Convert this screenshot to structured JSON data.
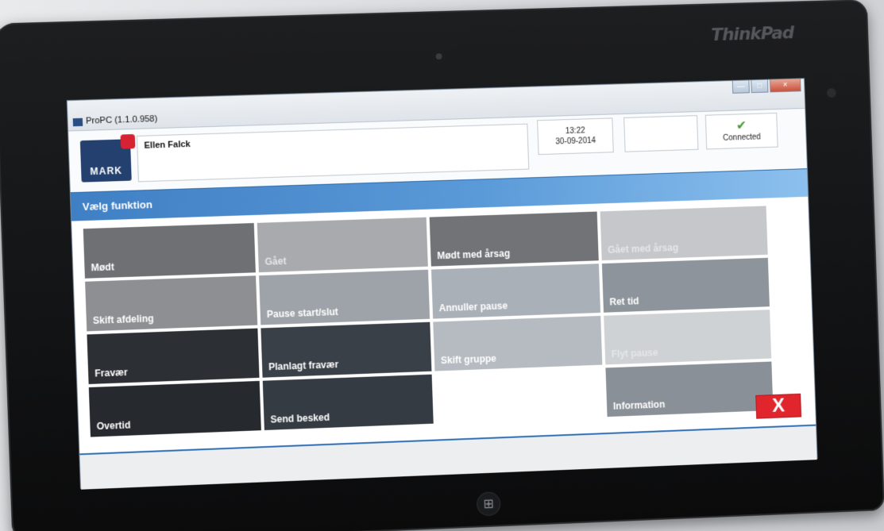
{
  "device": {
    "brand": "ThinkPad"
  },
  "window": {
    "title": "ProPC (1.1.0.958)",
    "controls": {
      "minimize": "—",
      "maximize": "□",
      "close": "×"
    }
  },
  "header": {
    "logo_text": "MARK",
    "user_name": "Ellen Falck",
    "time": "13:22",
    "date": "30-09-2014",
    "connection_status": "Connected",
    "connection_icon": "plug-icon"
  },
  "section": {
    "title": "Vælg funktion"
  },
  "tiles": [
    {
      "label": "Mødt",
      "color": "#6f7073",
      "enabled": true
    },
    {
      "label": "Gået",
      "color": "#a9aaad",
      "enabled": false
    },
    {
      "label": "Mødt med årsag",
      "color": "#727377",
      "enabled": true
    },
    {
      "label": "Gået med årsag",
      "color": "#c6c7ca",
      "enabled": false
    },
    {
      "label": "Skift afdeling",
      "color": "#8e8f92",
      "enabled": true
    },
    {
      "label": "Pause start/slut",
      "color": "#9da3a9",
      "enabled": true
    },
    {
      "label": "Annuller pause",
      "color": "#a9b0b7",
      "enabled": true
    },
    {
      "label": "Ret tid",
      "color": "#8d949b",
      "enabled": true
    },
    {
      "label": "Fravær",
      "color": "#2c2f33",
      "enabled": true
    },
    {
      "label": "Planlagt fravær",
      "color": "#3a4048",
      "enabled": true
    },
    {
      "label": "Skift gruppe",
      "color": "#b5bbc1",
      "enabled": true
    },
    {
      "label": "Flyt pause",
      "color": "#cfd2d5",
      "enabled": false
    },
    {
      "label": "Overtid",
      "color": "#26292d",
      "enabled": true
    },
    {
      "label": "Send besked",
      "color": "#353b43",
      "enabled": true
    },
    {
      "label": "",
      "color": "",
      "enabled": false
    },
    {
      "label": "Information",
      "color": "#8a9097",
      "enabled": true
    }
  ],
  "exit_button": {
    "label": "X",
    "color": "#e0252c"
  }
}
